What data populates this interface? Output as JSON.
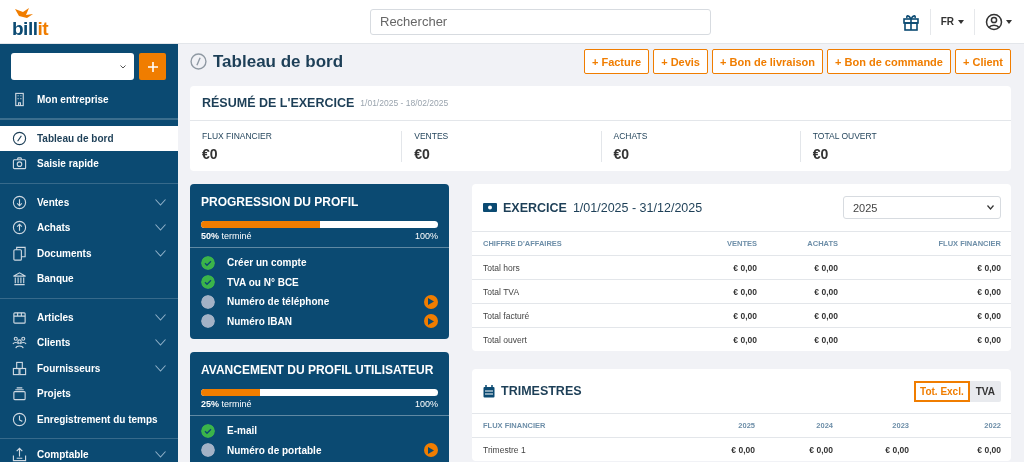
{
  "header": {
    "logo": {
      "first": "bill",
      "second": "it"
    },
    "search": {
      "placeholder": "Rechercher"
    },
    "language": "FR"
  },
  "sidebar": {
    "sections": [
      {
        "items": [
          {
            "label": "Mon entreprise",
            "selected": false,
            "has_submenu": false
          }
        ]
      },
      {
        "items": [
          {
            "label": "Tableau de bord",
            "selected": true,
            "has_submenu": false
          },
          {
            "label": "Saisie rapide",
            "selected": false,
            "has_submenu": false
          }
        ]
      },
      {
        "items": [
          {
            "label": "Ventes",
            "selected": false,
            "has_submenu": true
          },
          {
            "label": "Achats",
            "selected": false,
            "has_submenu": true
          },
          {
            "label": "Documents",
            "selected": false,
            "has_submenu": true
          },
          {
            "label": "Banque",
            "selected": false,
            "has_submenu": false
          }
        ]
      },
      {
        "items": [
          {
            "label": "Articles",
            "selected": false,
            "has_submenu": true
          },
          {
            "label": "Clients",
            "selected": false,
            "has_submenu": true
          },
          {
            "label": "Fournisseurs",
            "selected": false,
            "has_submenu": true
          },
          {
            "label": "Projets",
            "selected": false,
            "has_submenu": false
          },
          {
            "label": "Enregistrement du temps",
            "selected": false,
            "has_submenu": false
          }
        ]
      },
      {
        "items": [
          {
            "label": "Comptable",
            "selected": false,
            "has_submenu": true
          }
        ]
      }
    ]
  },
  "page": {
    "title": "Tableau de bord",
    "actions": [
      "+ Facture",
      "+ Devis",
      "+ Bon de livraison",
      "+ Bon de commande",
      "+ Client"
    ]
  },
  "summary": {
    "title": "RÉSUMÉ DE L'EXERCICE",
    "period": "1/01/2025 - 18/02/2025",
    "stats": [
      {
        "label": "FLUX FINANCIER",
        "value": "€0"
      },
      {
        "label": "VENTES",
        "value": "€0"
      },
      {
        "label": "ACHATS",
        "value": "€0"
      },
      {
        "label": "TOTAL OUVERT",
        "value": "€0"
      }
    ]
  },
  "profile_cards": [
    {
      "title": "PROGRESSION DU PROFIL",
      "level": 0.5,
      "progress_text": "**50%** terminé",
      "max": "100%",
      "items": [
        {
          "label": "Créer un compte",
          "done": true
        },
        {
          "label": "TVA ou N° BCE",
          "done": true
        },
        {
          "label": "Numéro de téléphone",
          "done": false
        },
        {
          "label": "Numéro IBAN",
          "done": false
        }
      ]
    },
    {
      "title": "AVANCEMENT DU PROFIL UTILISATEUR",
      "level": 0.25,
      "progress_text": "**25%** terminé",
      "max": "100%",
      "items": [
        {
          "label": "E-mail",
          "done": true
        },
        {
          "label": "Numéro de portable",
          "done": false
        }
      ]
    }
  ],
  "exercise": {
    "title": "EXERCICE",
    "period": "1/01/2025 - 31/12/2025",
    "year": "2025",
    "columns": [
      "CHIFFRE D'AFFAIRES",
      "VENTES",
      "ACHATS",
      "FLUX FINANCIER"
    ],
    "rows": [
      [
        "Total hors",
        "€ 0,00",
        "€ 0,00",
        "€ 0,00"
      ],
      [
        "Total TVA",
        "€ 0,00",
        "€ 0,00",
        "€ 0,00"
      ],
      [
        "Total facturé",
        "€ 0,00",
        "€ 0,00",
        "€ 0,00"
      ],
      [
        "Total ouvert",
        "€ 0,00",
        "€ 0,00",
        "€ 0,00"
      ]
    ]
  },
  "quarters": {
    "title": "TRIMESTRES",
    "toggle": [
      {
        "label": "Tot. Excl.",
        "selected": true
      },
      {
        "label": "TVA",
        "selected": false
      }
    ],
    "columns": [
      "FLUX FINANCIER",
      "2025",
      "2024",
      "2023",
      "2022"
    ],
    "rows": [
      [
        "Trimestre 1",
        "€ 0,00",
        "€ 0,00",
        "€ 0,00",
        "€ 0,00"
      ]
    ]
  }
}
